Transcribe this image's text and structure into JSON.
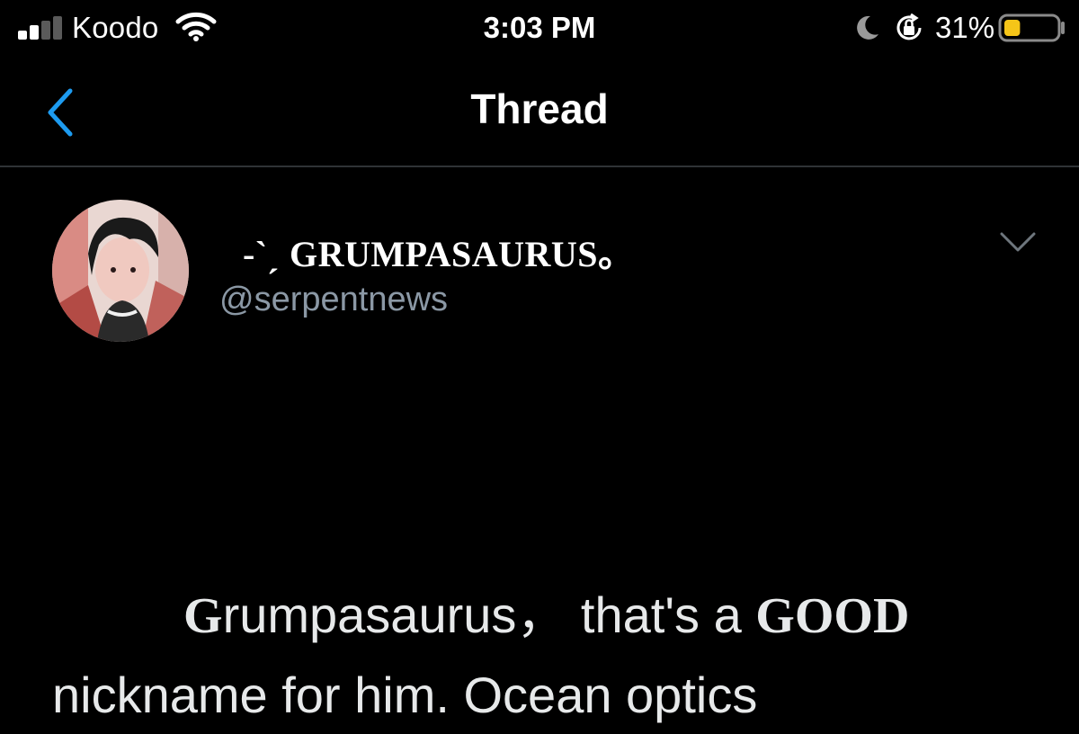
{
  "status_bar": {
    "carrier": "Koodo",
    "time": "3:03 PM",
    "battery_percent": "31%",
    "battery_level": 0.31,
    "icons": [
      "signal-bars-icon",
      "wifi-icon",
      "moon-icon",
      "rotation-lock-icon",
      "battery-icon"
    ],
    "colors": {
      "battery_fill": "#f5c518",
      "signal_dim": "#5a5a5a"
    }
  },
  "header": {
    "back_icon": "chevron-left-icon",
    "title": "Thread",
    "accent_color": "#1d9bf0"
  },
  "tweet": {
    "display_name": "-`ˏ GRUMPASAURUS。",
    "handle": "@serpentnews",
    "menu_icon": "chevron-down-icon",
    "body": {
      "line1_first_letter": "G",
      "line1_rest": "rumpasaurus，  that's a ",
      "line1_bold": "GOOD",
      "line2": "nickname for him.  Ocean optics"
    }
  }
}
